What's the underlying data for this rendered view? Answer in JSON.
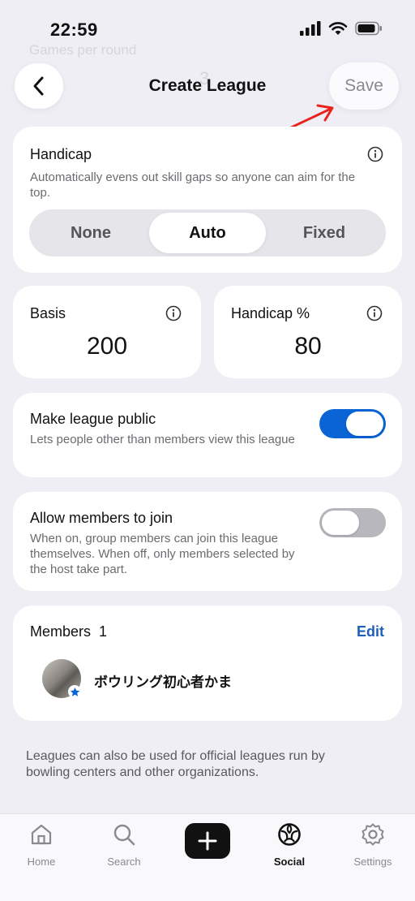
{
  "status_bar": {
    "time": "22:59"
  },
  "background": {
    "ghost_label": "Games per round",
    "ghost_value": "3"
  },
  "header": {
    "title": "Create League",
    "save_label": "Save"
  },
  "handicap": {
    "title": "Handicap",
    "description": "Automatically evens out skill gaps so anyone can aim for the top.",
    "options": [
      "None",
      "Auto",
      "Fixed"
    ],
    "selected": "Auto"
  },
  "basis": {
    "label": "Basis",
    "value": "200"
  },
  "handicap_percent": {
    "label": "Handicap %",
    "value": "80"
  },
  "public_toggle": {
    "title": "Make league public",
    "description": "Lets people other than members view this league",
    "on": true
  },
  "join_toggle": {
    "title": "Allow members to join",
    "description": "When on, group members can join this league themselves. When off, only members selected by the host take part.",
    "on": false
  },
  "members": {
    "title": "Members",
    "count": "1",
    "edit_label": "Edit",
    "list": [
      {
        "name": "ボウリング初心者かま"
      }
    ]
  },
  "footer_note": "Leagues can also be used for official leagues run by bowling centers and other organizations.",
  "tab_bar": {
    "items": [
      {
        "label": "Home",
        "icon": "home-icon"
      },
      {
        "label": "Search",
        "icon": "search-icon"
      },
      {
        "label": "",
        "icon": "plus-icon"
      },
      {
        "label": "Social",
        "icon": "social-icon"
      },
      {
        "label": "Settings",
        "icon": "gear-icon"
      }
    ],
    "active": "Social"
  },
  "colors": {
    "accent": "#0a64d6",
    "link": "#1d5fb8",
    "annotation": "#e8241c"
  }
}
